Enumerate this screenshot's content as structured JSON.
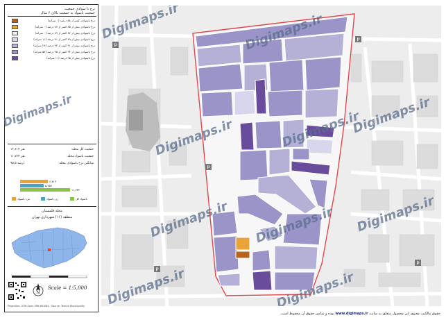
{
  "legend": {
    "title_line1": "نرخ با سوادی جمعیت",
    "title_line2": "جمعیت باسواد به جمعیت بالای ۶ سال",
    "classes": [
      {
        "label": "نرخ باسوادی کمتر از ۸۵ درصد (۰ سرانه)",
        "color": "#b5651d"
      },
      {
        "label": "نرخ باسوادی بیش از ۸۵ کمتر از ۸۷ درصد (۰ سرانه)",
        "color": "#e8a33a"
      },
      {
        "label": "نرخ باسوادی بیش از ۸۷ کمتر از ۸۹ درصد (۰ سرانه)",
        "color": "#efefef"
      },
      {
        "label": "نرخ باسوادی بیش از ۸۹ کمتر از ۹۱ درصد (۱۱ سرانه)",
        "color": "#d8d6ec"
      },
      {
        "label": "نرخ باسوادی بیش از ۹۱ کمتر از ۹۳ درصد (۲۸ سرانه)",
        "color": "#b4b0d6"
      },
      {
        "label": "نرخ باسوادی بیش از ۹۳ کمتر از ۹۵ درصد (۵۸ سرانه)",
        "color": "#9a94c8"
      },
      {
        "label": "نرخ باسوادی بیش از ۹۵ درصد (۱۱ سرانه)",
        "color": "#6a4c9c"
      }
    ]
  },
  "stats": [
    {
      "key": "جمعیت کل محله:",
      "value": "۱۳,۶۱۴ نفر"
    },
    {
      "key": "جمعیت باسواد محله:",
      "value": "۱۱,۷۳۴ نفر"
    },
    {
      "key": "میانگین نرخ باسوادی محله:",
      "value": "۹۵,۵ درصد"
    }
  ],
  "bars": [
    {
      "label": "۶,۸۱۳",
      "color": "#e8a33a",
      "fraction": 0.42
    },
    {
      "label": "۵,۷۵۷",
      "color": "#4aa3c9",
      "fraction": 0.35
    },
    {
      "label": "۱۱,۷۳۴",
      "color": "#8bc34a",
      "fraction": 0.75
    }
  ],
  "bar_legend": [
    {
      "label": "باسواد کل",
      "color": "#8bc34a"
    },
    {
      "label": "زن باسواد",
      "color": "#4aa3c9"
    },
    {
      "label": "مرد باسواد",
      "color": "#e8a33a"
    }
  ],
  "region": {
    "line1": "محله قلمستان",
    "line2": "منطقه (۱۱) شهرداری تهران"
  },
  "scale_text": "Scale = 1:5,000",
  "footer_small": "Projection: UTM Zone 39N WGS84 · Source: Tehran Municipality",
  "watermarks": [
    "Digimaps.ir",
    "Digimaps.ir",
    "Digimaps.ir",
    "Digimaps.ir",
    "Digimaps.ir",
    "Digimaps.ir",
    "Digimaps.ir",
    "Digimaps.ir",
    "Digimaps.ir",
    "Digimaps.ir"
  ],
  "bottom_note_pre": "حقوق مالکیت معنوی این محصول متعلق به سایت",
  "bottom_note_site": "www.digimaps.ir",
  "bottom_note_post": "بوده و تمامی حقوق آن محفوظ است."
}
